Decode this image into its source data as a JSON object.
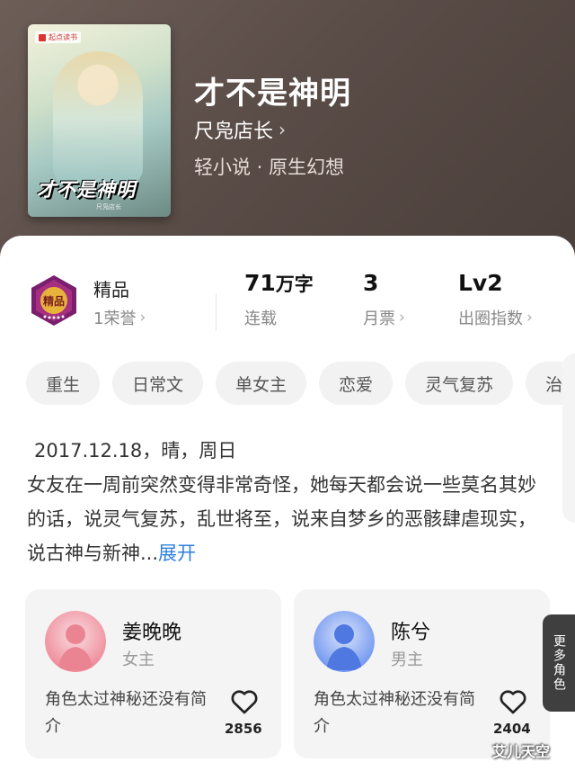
{
  "book": {
    "title": "才不是神明",
    "author": "尺凫店长",
    "author_chevron": "›",
    "genre": "轻小说 · 原生幻想",
    "cover": {
      "publisher": "起点读书",
      "title": "才不是神明",
      "author": "尺凫店长"
    }
  },
  "stats": {
    "badge_label": "精品",
    "honors": "1荣誉",
    "word_count": "71",
    "word_unit": "万字",
    "status": "连载",
    "monthly_tickets": "3",
    "monthly_tickets_label": "月票",
    "level": "Lv2",
    "level_label": "出圈指数"
  },
  "tags": [
    "重生",
    "日常文",
    "单女主",
    "恋爱",
    "灵气复苏",
    "治"
  ],
  "synopsis": {
    "date_line": "2017.12.18，晴，周日",
    "body": "女友在一周前突然变得非常奇怪，她每天都会说一些莫名其妙的话，说灵气复苏，乱世将至，说来自梦乡的恶骸肆虐现实，说古神与新神...",
    "expand": "展开"
  },
  "characters": [
    {
      "name": "姜晚晚",
      "role": "女主",
      "desc": "角色太过神秘还没有简介",
      "likes": "2856",
      "color": "#f08a9a"
    },
    {
      "name": "陈兮",
      "role": "男主",
      "desc": "角色太过神秘还没有简介",
      "likes": "2404",
      "color": "#6f95f0"
    }
  ],
  "more_roles": "更多角色",
  "watermark": "艾儿天空"
}
